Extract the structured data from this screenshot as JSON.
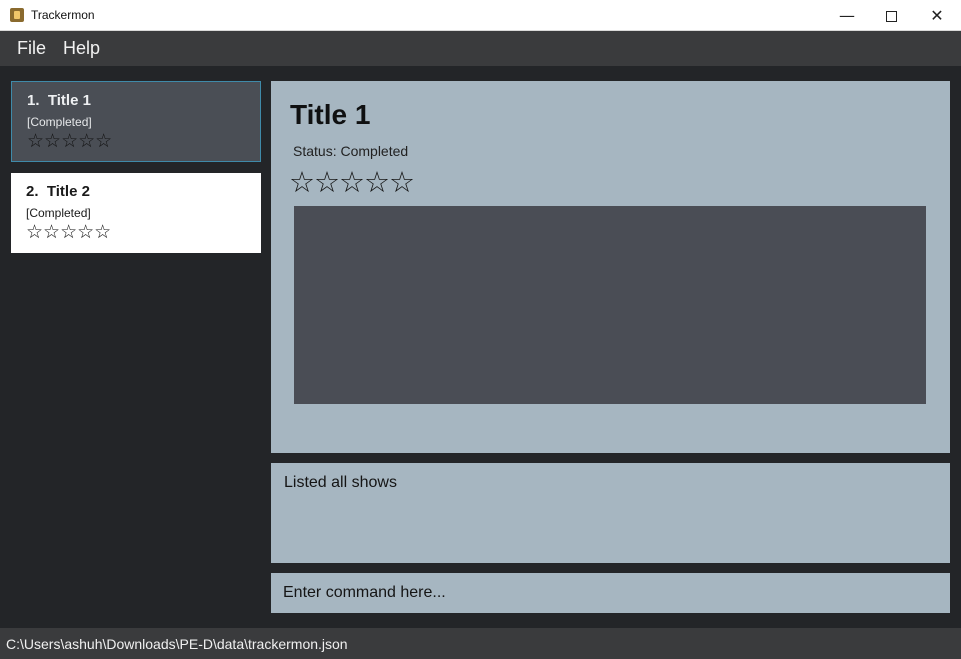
{
  "window": {
    "title": "Trackermon",
    "min_glyph": "—",
    "close_glyph": "✕"
  },
  "menu": {
    "file": "File",
    "help": "Help"
  },
  "shows": [
    {
      "index": "1.",
      "title": "Title 1",
      "status": "[Completed]",
      "rating_stars": "☆☆☆☆☆",
      "rating": 0,
      "selected": true
    },
    {
      "index": "2.",
      "title": "Title 2",
      "status": "[Completed]",
      "rating_stars": "☆☆☆☆☆",
      "rating": 0,
      "selected": false
    }
  ],
  "detail": {
    "title": "Title 1",
    "status": "Status: Completed",
    "rating_stars": "☆☆☆☆☆",
    "rating": 0
  },
  "result": {
    "text": "Listed all shows"
  },
  "command": {
    "placeholder": "Enter command here...",
    "value": ""
  },
  "statusbar": {
    "path": "C:\\Users\\ashuh\\Downloads\\PE-D\\data\\trackermon.json"
  },
  "colors": {
    "background": "#232528",
    "panel": "#a6b6c1",
    "selected_card": "#4a4e55",
    "selected_border": "#3f8aa9",
    "card": "#ffffff",
    "description_box": "#4a4d55",
    "bar": "#3a3b3d"
  }
}
